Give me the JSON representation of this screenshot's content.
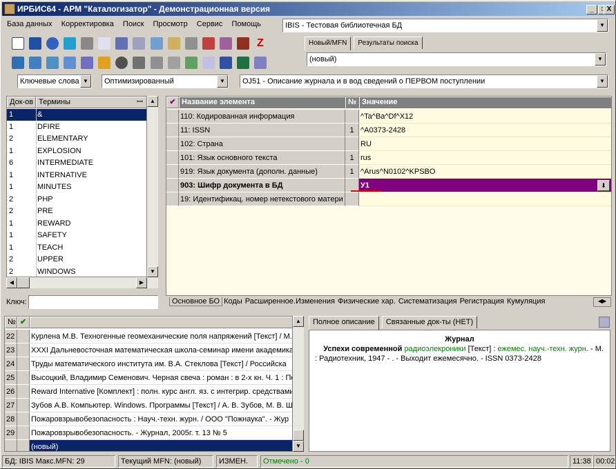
{
  "window": {
    "title": "ИРБИС64 - АРМ \"Каталогизатор\" - Демонстрационная версия",
    "min": "_",
    "max": "□",
    "close": "X"
  },
  "menu": [
    "База данных",
    "Корректировка",
    "Поиск",
    "Просмотр",
    "Сервис",
    "Помощь"
  ],
  "db_combo": "IBIS - Тестовая библиотечная БД",
  "record_tabs": [
    "Новый/MFN",
    "Результаты поиска"
  ],
  "record_combo": "(новый)",
  "search_combo": "Ключевые слова",
  "opt_combo": "Оптимизированный",
  "worksheet_combo": "OJ51 - Описание журнала и в вод сведений о ПЕРВОМ поступлении",
  "dict": {
    "col_count": "Док-ов",
    "col_term": "Термины",
    "rows": [
      {
        "count": "1",
        "term": "&"
      },
      {
        "count": "1",
        "term": "DFIRE"
      },
      {
        "count": "2",
        "term": "ELEMENTARY"
      },
      {
        "count": "1",
        "term": "EXPLOSION"
      },
      {
        "count": "6",
        "term": "INTERMEDIATE"
      },
      {
        "count": "1",
        "term": "INTERNATIVE"
      },
      {
        "count": "1",
        "term": "MINUTES"
      },
      {
        "count": "2",
        "term": "PHP"
      },
      {
        "count": "2",
        "term": "PRE"
      },
      {
        "count": "1",
        "term": "REWARD"
      },
      {
        "count": "1",
        "term": "SAFETY"
      },
      {
        "count": "1",
        "term": "TEACH"
      },
      {
        "count": "2",
        "term": "UPPER"
      },
      {
        "count": "2",
        "term": "WINDOWS"
      }
    ],
    "key_label": "Ключ:"
  },
  "editor": {
    "col_name": "Название элемента",
    "col_no": "№",
    "col_value": "Значение",
    "rows": [
      {
        "name": "110: Кодированная информация",
        "no": "",
        "value": "^Ta^Ba^Df^X12"
      },
      {
        "name": "11: ISSN",
        "no": "1",
        "value": "^A0373-2428"
      },
      {
        "name": "102: Страна",
        "no": "",
        "value": "RU"
      },
      {
        "name": "101: Язык основного текста",
        "no": "1",
        "value": "rus"
      },
      {
        "name": "919: Язык документа (дополн. данные)",
        "no": "1",
        "value": "^Arus^N0102^KPSBO"
      },
      {
        "name": "903: Шифр документа в БД",
        "no": "",
        "value": "У1"
      },
      {
        "name": "19: Идентификац. номер нетекстового матери",
        "no": "",
        "value": ""
      }
    ],
    "tabs": [
      "Основное БО",
      "Коды",
      "Расширенное.Изменения",
      "Физические хар.",
      "Систематизация",
      "Регистрация",
      "Кумуляция"
    ]
  },
  "list": {
    "col_no": "№",
    "rows": [
      {
        "no": "22",
        "text": "Курлена М.В. Техногенные геомеханические поля напряжений [Текст] / М."
      },
      {
        "no": "23",
        "text": "XXXI Дальневосточная математическая школа-семинар имени академика"
      },
      {
        "no": "24",
        "text": "Труды математического института им. В.А. Стеклова [Текст] / Российска"
      },
      {
        "no": "25",
        "text": "Высоцкий, Владимир Семенович. Черная свеча : роман : в 2-х кн. Ч. 1 : По"
      },
      {
        "no": "26",
        "text": "Reward Internative [Комплект] : полн. курс англ. яз. с интегрир. средствами"
      },
      {
        "no": "27",
        "text": "Зубов А.В. Компьютер. Windows. Программы [Текст] / А. В. Зубов, М. В. Ш"
      },
      {
        "no": "28",
        "text": "Пожаровзрывобезопасность : Науч.-техн. журн. / ООО \"Пожнаука\". - Жур"
      },
      {
        "no": "29",
        "text": "Пожаровзрывобезопасность. - Журнал, 2005г. т. 13 № 5"
      },
      {
        "no": "",
        "text": "(новый)"
      }
    ]
  },
  "desc": {
    "tabs": [
      "Полное описание",
      "Связанные док-ты (НЕТ)"
    ],
    "type": "Журнал",
    "title_bold": "Успехи современной",
    "title_green": "радиоэлекроники",
    "t1": "[Текст] :",
    "t2": "ежемес. науч.-техн. журн.",
    "t3": "- М.",
    "t4": ": Радиотехник, 1947 -      . - Выходит ежемесячно. - ISSN 0373-2428"
  },
  "status": {
    "db": "БД: IBIS Макс.MFN: 29",
    "mfn": "Текущий MFN: (новый)",
    "changed": "ИЗМЕН.",
    "marked": "Отмечено - 0",
    "time": "11:38",
    "clock": "00:02"
  }
}
